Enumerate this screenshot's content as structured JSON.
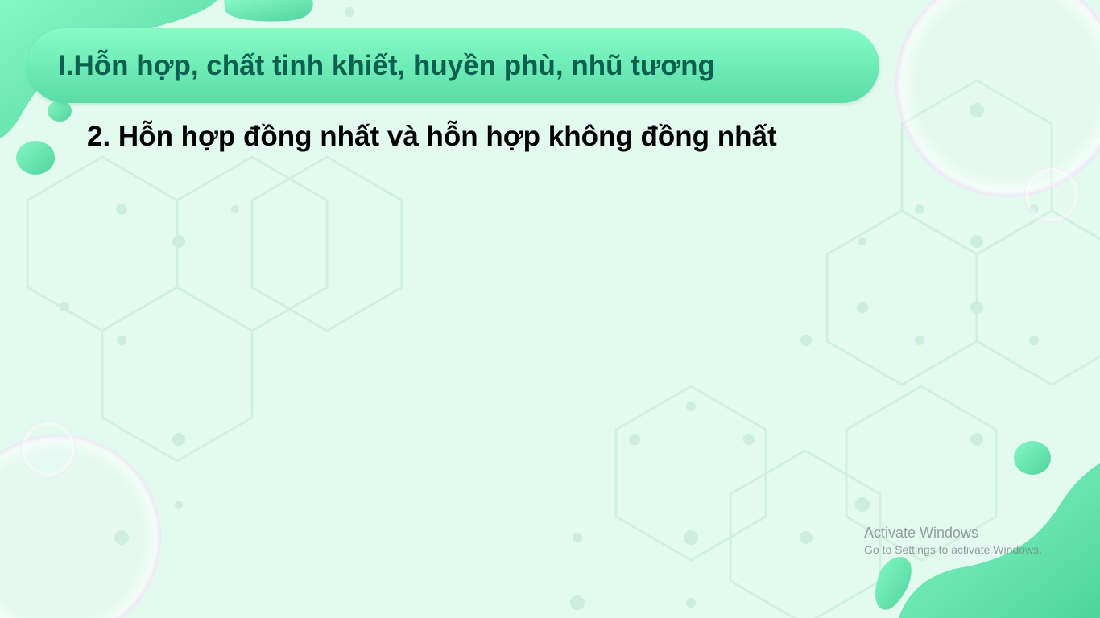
{
  "slide": {
    "title": "I.Hỗn hợp, chất tinh khiết, huyền phù, nhũ tương",
    "subtitle": "2. Hỗn hợp đồng nhất và hỗn hợp không đồng nhất"
  },
  "watermark": {
    "title": "Activate Windows",
    "subtitle": "Go to Settings to activate Windows."
  },
  "colors": {
    "background": "#e3faf0",
    "title_pill": "#6ae9b4",
    "title_text": "#0d5f50",
    "subtitle_text": "#000000",
    "blob": "#5fe0ac"
  },
  "icons": [
    "hexagon-pattern",
    "green-blob",
    "soap-bubble"
  ]
}
